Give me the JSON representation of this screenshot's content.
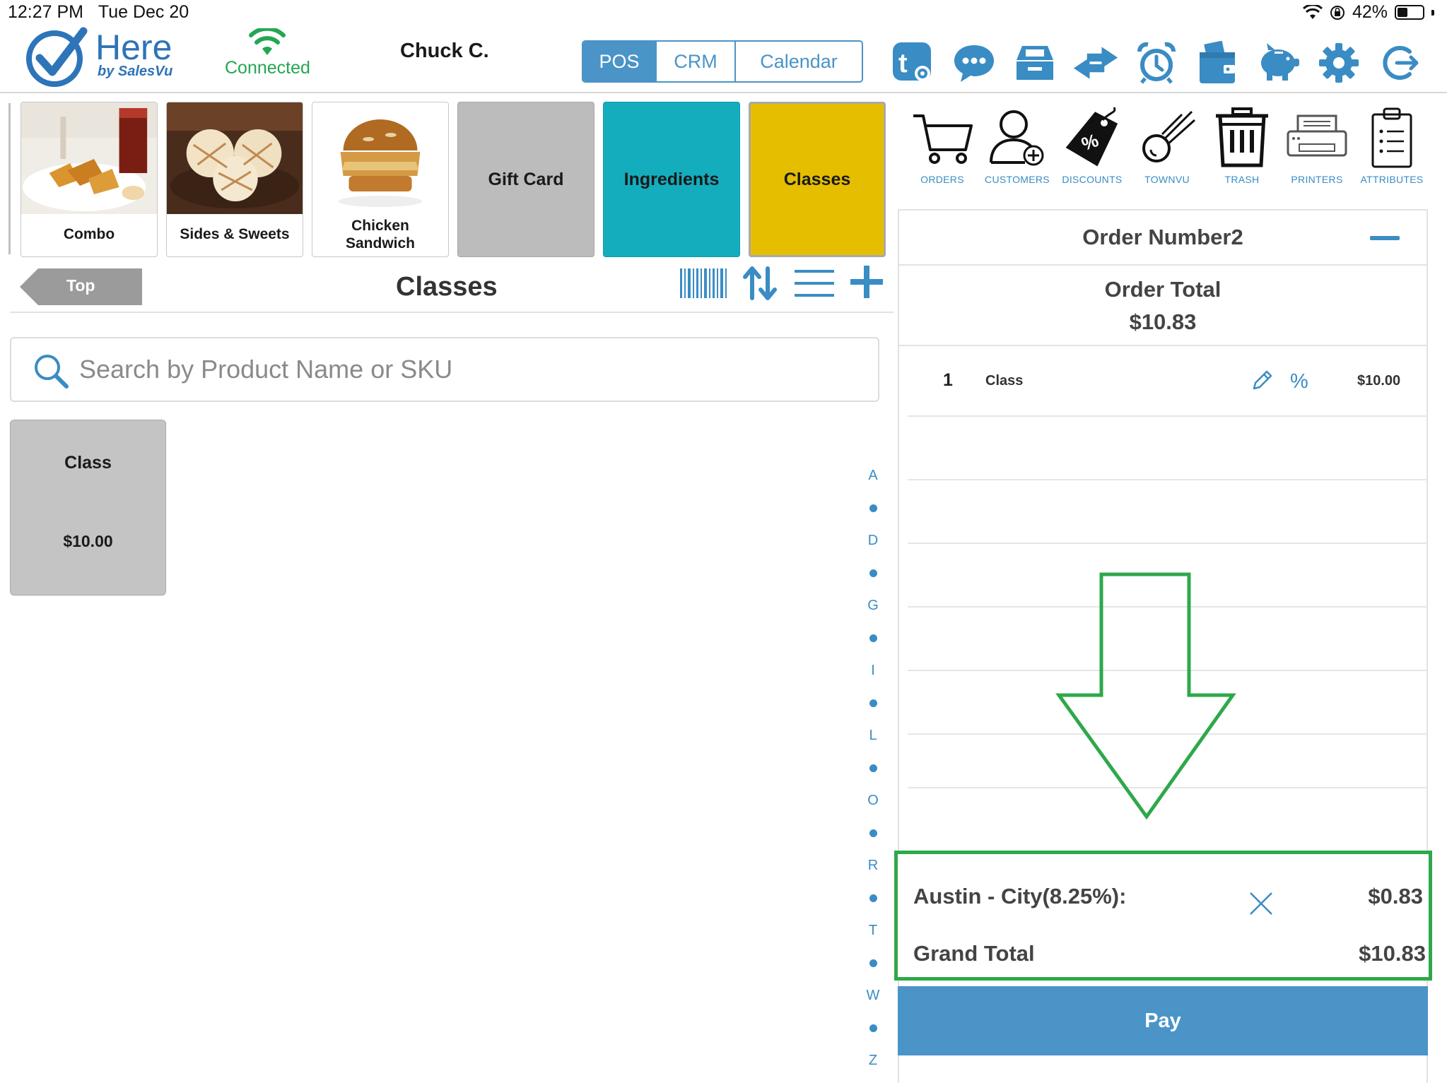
{
  "status": {
    "time": "12:27 PM",
    "date": "Tue Dec 20",
    "battery": "42%",
    "battery_level": 0.42
  },
  "header": {
    "logo_word": "Here",
    "logo_sub": "by SalesVu",
    "connection": "Connected",
    "user": "Chuck C.",
    "tabs": [
      {
        "label": "POS",
        "active": true
      },
      {
        "label": "CRM",
        "active": false
      },
      {
        "label": "Calendar",
        "active": false
      }
    ],
    "icons": [
      "townvu-settings-icon",
      "chat-icon",
      "cash-drawer-icon",
      "transfer-icon",
      "alarm-clock-icon",
      "wallet-icon",
      "piggy-bank-icon",
      "gear-icon",
      "logout-icon"
    ]
  },
  "categories": [
    {
      "label": "Combo",
      "type": "image"
    },
    {
      "label": "Sides & Sweets",
      "type": "image"
    },
    {
      "label": "Chicken\nSandwich",
      "type": "image"
    },
    {
      "label": "Gift Card",
      "type": "solid",
      "color": "#bcbcbc"
    },
    {
      "label": "Ingredients",
      "type": "solid",
      "color": "#14adbe"
    },
    {
      "label": "Classes",
      "type": "solid",
      "color": "#e6be00"
    }
  ],
  "nav": {
    "back_label": "Top",
    "section_title": "Classes"
  },
  "search": {
    "placeholder": "Search by Product Name or SKU",
    "value": ""
  },
  "products": [
    {
      "name": "Class",
      "price": "$10.00"
    }
  ],
  "alphabet": [
    "A",
    "D",
    "G",
    "I",
    "L",
    "O",
    "R",
    "T",
    "W",
    "Z"
  ],
  "toolbar": [
    {
      "label": "ORDERS",
      "icon": "cart-icon"
    },
    {
      "label": "CUSTOMERS",
      "icon": "add-customer-icon"
    },
    {
      "label": "DISCOUNTS",
      "icon": "discount-tag-icon"
    },
    {
      "label": "TOWNVU",
      "icon": "comet-icon"
    },
    {
      "label": "TRASH",
      "icon": "trash-icon"
    },
    {
      "label": "PRINTERS",
      "icon": "printer-icon"
    },
    {
      "label": "ATTRIBUTES",
      "icon": "clipboard-icon"
    }
  ],
  "order": {
    "title": "Order Number2",
    "total_label": "Order Total",
    "total_value": "$10.83",
    "lines": [
      {
        "qty": "1",
        "name": "Class",
        "discount_symbol": "%",
        "price": "$10.00"
      }
    ],
    "tax_label": "Austin - City(8.25%):",
    "tax_value": "$0.83",
    "grand_label": "Grand Total",
    "grand_value": "$10.83",
    "pay_label": "Pay"
  },
  "colors": {
    "accent": "#4a94c8",
    "connected": "#24a652",
    "highlight": "#2ea84a"
  }
}
